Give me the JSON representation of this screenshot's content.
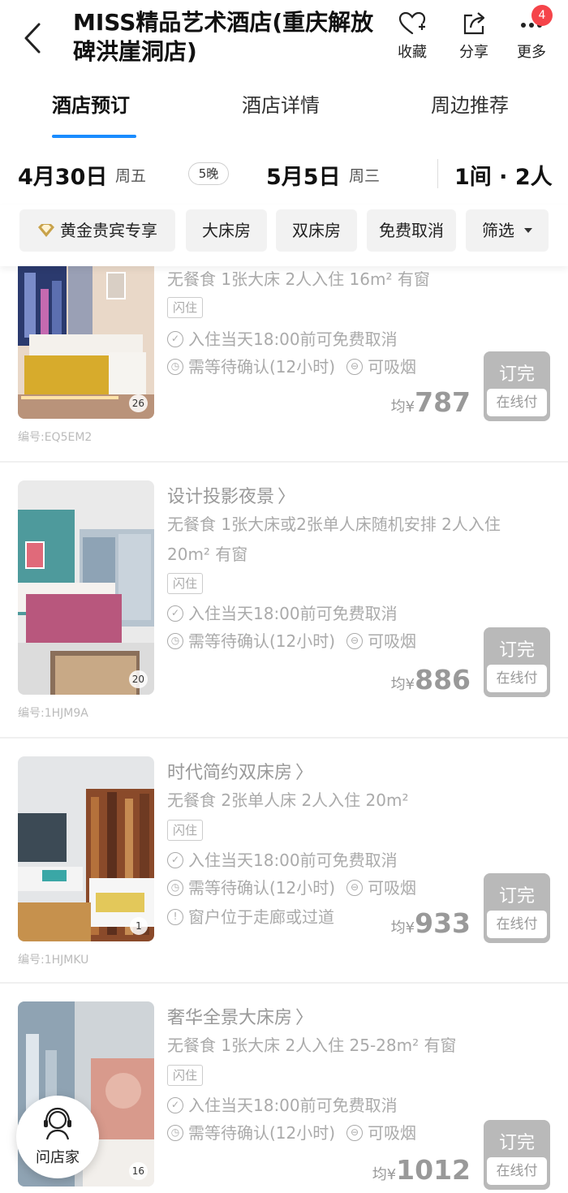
{
  "header": {
    "title": "MISS精品艺术酒店(重庆解放碑洪崖洞店)",
    "favorite_label": "收藏",
    "share_label": "分享",
    "more_label": "更多",
    "more_badge": "4"
  },
  "tabs": [
    "酒店预订",
    "酒店详情",
    "周边推荐"
  ],
  "dates": {
    "checkin": "4月30日",
    "checkin_weekday": "周五",
    "nights": "5晚",
    "checkout": "5月5日",
    "checkout_weekday": "周三",
    "guests": "1间 · 2人"
  },
  "filters": [
    "黄金贵宾专享",
    "大床房",
    "双床房",
    "免费取消",
    "筛选"
  ],
  "rooms": [
    {
      "name": "",
      "info_1": "无餐食  1张大床  2人入住  16m² 有窗",
      "info_2": "",
      "tag": "闪住",
      "cancel": "入住当天18:00前可免费取消",
      "confirm": "需等待确认(12小时)",
      "smoking": "可吸烟",
      "note": "",
      "price_prefix": "均",
      "currency": "¥",
      "price": "787",
      "status": "订完",
      "pay": "在线付",
      "photo_count": "26",
      "code": "编号:EQ5EM2"
    },
    {
      "name": "设计投影夜景",
      "info_1": "无餐食  1张大床或2张单人床随机安排  2人入住",
      "info_2": "20m² 有窗",
      "tag": "闪住",
      "cancel": "入住当天18:00前可免费取消",
      "confirm": "需等待确认(12小时)",
      "smoking": "可吸烟",
      "note": "",
      "price_prefix": "均",
      "currency": "¥",
      "price": "886",
      "status": "订完",
      "pay": "在线付",
      "photo_count": "20",
      "code": "编号:1HJM9A"
    },
    {
      "name": "时代简约双床房",
      "info_1": "无餐食  2张单人床  2人入住  20m²",
      "info_2": "",
      "tag": "闪住",
      "cancel": "入住当天18:00前可免费取消",
      "confirm": "需等待确认(12小时)",
      "smoking": "可吸烟",
      "note": "窗户位于走廊或过道",
      "price_prefix": "均",
      "currency": "¥",
      "price": "933",
      "status": "订完",
      "pay": "在线付",
      "photo_count": "1",
      "code": "编号:1HJMKU"
    },
    {
      "name": "奢华全景大床房",
      "info_1": "无餐食  1张大床  2人入住  25-28m² 有窗",
      "info_2": "",
      "tag": "闪住",
      "cancel": "入住当天18:00前可免费取消",
      "confirm": "需等待确认(12小时)",
      "smoking": "可吸烟",
      "note": "",
      "price_prefix": "均",
      "currency": "¥",
      "price": "1012",
      "status": "订完",
      "pay": "在线付",
      "photo_count": "16",
      "code": ""
    }
  ],
  "ask_label": "问店家",
  "colors": {
    "accent": "#1a8cff",
    "badge": "#f5444a",
    "soldout": "#b9b9b9",
    "gold": "#c8a24a"
  }
}
